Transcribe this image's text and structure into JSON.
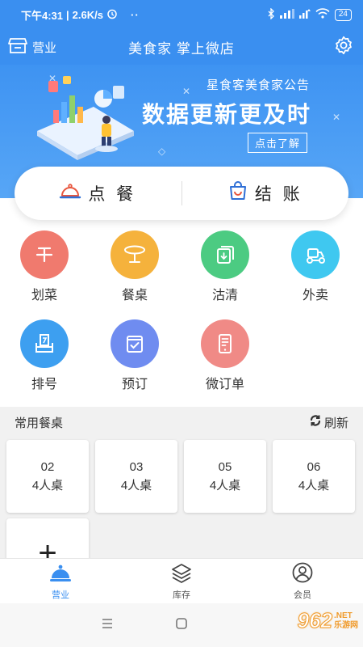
{
  "status_bar": {
    "time": "下午4:31",
    "speed": "2.6K/s",
    "dots": "··",
    "battery": "24"
  },
  "header": {
    "left_label": "营业",
    "title": "美食家 掌上微店"
  },
  "banner": {
    "notice": "星食客美食家公告",
    "headline": "数据更新更及时",
    "link": "点击了解"
  },
  "actions": {
    "order": "点 餐",
    "checkout": "结 账"
  },
  "grid": [
    {
      "label": "划菜",
      "color": "#f07a6e",
      "icon": "strike-dish-icon"
    },
    {
      "label": "餐桌",
      "color": "#f5b23c",
      "icon": "table-icon"
    },
    {
      "label": "沽清",
      "color": "#4ccb82",
      "icon": "sold-out-icon"
    },
    {
      "label": "外卖",
      "color": "#3fc8f0",
      "icon": "delivery-icon"
    },
    {
      "label": "排号",
      "color": "#3d9ff0",
      "icon": "queue-number-icon"
    },
    {
      "label": "预订",
      "color": "#6f8cf0",
      "icon": "reservation-icon"
    },
    {
      "label": "微订单",
      "color": "#f08a86",
      "icon": "micro-order-icon"
    }
  ],
  "tables_section": {
    "title": "常用餐桌",
    "refresh": "刷新",
    "tables": [
      {
        "number": "02",
        "seats": "4人桌"
      },
      {
        "number": "03",
        "seats": "4人桌"
      },
      {
        "number": "05",
        "seats": "4人桌"
      },
      {
        "number": "06",
        "seats": "4人桌"
      }
    ],
    "add": "+"
  },
  "bottom_nav": [
    {
      "label": "营业",
      "icon": "cloche-icon",
      "active": true
    },
    {
      "label": "库存",
      "icon": "layers-icon",
      "active": false
    },
    {
      "label": "会员",
      "icon": "user-icon",
      "active": false
    }
  ],
  "watermark": {
    "number": "962",
    "suffix": ".NET",
    "name": "乐游网"
  },
  "colors": {
    "primary": "#3a8ff0",
    "section_bg": "#f1f1f1"
  }
}
